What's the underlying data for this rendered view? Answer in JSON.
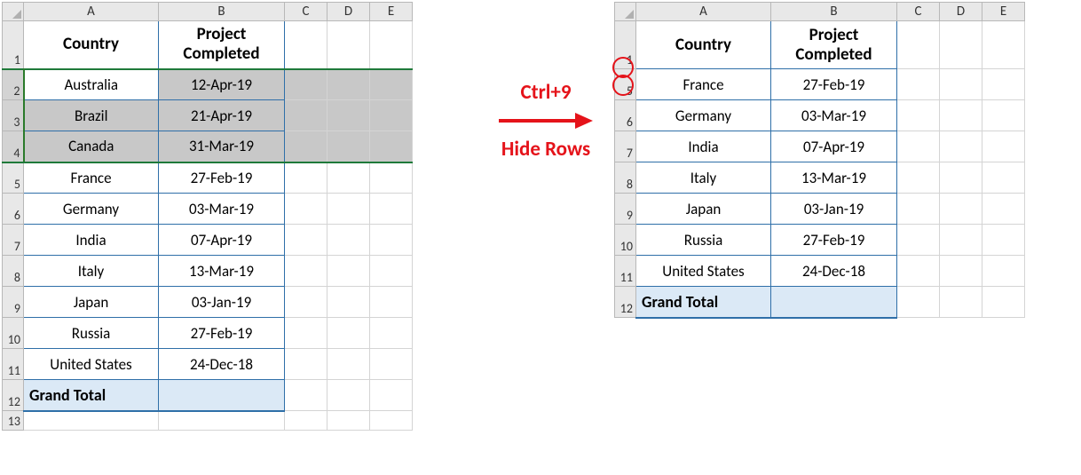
{
  "columns": [
    "A",
    "B",
    "C",
    "D",
    "E"
  ],
  "left": {
    "rows": [
      "1",
      "2",
      "3",
      "4",
      "5",
      "6",
      "7",
      "8",
      "9",
      "10",
      "11",
      "12",
      "13"
    ],
    "headers": {
      "colA": "Country",
      "colB": "Project\nCompleted"
    },
    "data": [
      {
        "c": "Australia",
        "d": "12-Apr-19"
      },
      {
        "c": "Brazil",
        "d": "21-Apr-19"
      },
      {
        "c": "Canada",
        "d": "31-Mar-19"
      },
      {
        "c": "France",
        "d": "27-Feb-19"
      },
      {
        "c": "Germany",
        "d": "03-Mar-19"
      },
      {
        "c": "India",
        "d": "07-Apr-19"
      },
      {
        "c": "Italy",
        "d": "13-Mar-19"
      },
      {
        "c": "Japan",
        "d": "03-Jan-19"
      },
      {
        "c": "Russia",
        "d": "27-Feb-19"
      },
      {
        "c": "United States",
        "d": "24-Dec-18"
      }
    ],
    "total": "Grand Total",
    "selected_rows": [
      "2",
      "3",
      "4"
    ]
  },
  "right": {
    "rows": [
      "1",
      "5",
      "6",
      "7",
      "8",
      "9",
      "10",
      "11",
      "12"
    ],
    "headers": {
      "colA": "Country",
      "colB": "Project\nCompleted"
    },
    "data": [
      {
        "c": "France",
        "d": "27-Feb-19"
      },
      {
        "c": "Germany",
        "d": "03-Mar-19"
      },
      {
        "c": "India",
        "d": "07-Apr-19"
      },
      {
        "c": "Italy",
        "d": "13-Mar-19"
      },
      {
        "c": "Japan",
        "d": "03-Jan-19"
      },
      {
        "c": "Russia",
        "d": "27-Feb-19"
      },
      {
        "c": "United States",
        "d": "24-Dec-18"
      }
    ],
    "total": "Grand Total",
    "circled_rows": [
      "1",
      "5"
    ]
  },
  "annotation": {
    "top": "Ctrl+9",
    "bottom": "Hide Rows"
  }
}
